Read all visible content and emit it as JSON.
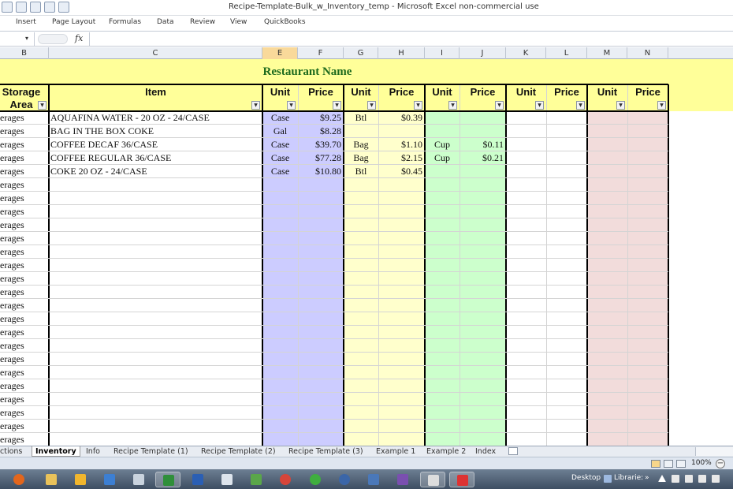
{
  "window": {
    "title": "Recipe-Template-Bulk_w_Inventory_temp  -  Microsoft Excel non-commercial use"
  },
  "ribbon": {
    "tabs": [
      "Insert",
      "Page Layout",
      "Formulas",
      "Data",
      "Review",
      "View",
      "QuickBooks"
    ]
  },
  "formula_bar": {
    "fx_label": "fx",
    "name_box_arrow": "▾"
  },
  "columns": [
    "B",
    "C",
    "E",
    "F",
    "G",
    "H",
    "I",
    "J",
    "K",
    "L",
    "M",
    "N"
  ],
  "selected_column": "E",
  "sheet": {
    "title": "Restaurant Name",
    "headers": {
      "storage_area_line1": "Storage",
      "storage_area_line2": "Area",
      "item": "Item",
      "unit1": "Unit",
      "price1": "Price",
      "unit2": "Unit",
      "price2": "Price",
      "unit3": "Unit",
      "price3": "Price",
      "unit4": "Unit",
      "price4": "Price",
      "unit5": "Unit",
      "price5": "Price"
    },
    "rows": [
      {
        "area": "erages",
        "item": "AQUAFINA WATER - 20 OZ - 24/CASE",
        "u1": "Case",
        "p1": "$9.25",
        "u2": "Btl",
        "p2": "$0.39",
        "u3": "",
        "p3": ""
      },
      {
        "area": "erages",
        "item": "BAG IN THE BOX COKE",
        "u1": "Gal",
        "p1": "$8.28",
        "u2": "",
        "p2": "",
        "u3": "",
        "p3": ""
      },
      {
        "area": "erages",
        "item": "COFFEE DECAF 36/CASE",
        "u1": "Case",
        "p1": "$39.70",
        "u2": "Bag",
        "p2": "$1.10",
        "u3": "Cup",
        "p3": "$0.11"
      },
      {
        "area": "erages",
        "item": "COFFEE REGULAR 36/CASE",
        "u1": "Case",
        "p1": "$77.28",
        "u2": "Bag",
        "p2": "$2.15",
        "u3": "Cup",
        "p3": "$0.21"
      },
      {
        "area": "erages",
        "item": "COKE 20 OZ - 24/CASE",
        "u1": "Case",
        "p1": "$10.80",
        "u2": "Btl",
        "p2": "$0.45",
        "u3": "",
        "p3": ""
      },
      {
        "area": "erages",
        "item": "",
        "u1": "",
        "p1": "",
        "u2": "",
        "p2": "",
        "u3": "",
        "p3": ""
      },
      {
        "area": "erages",
        "item": "",
        "u1": "",
        "p1": "",
        "u2": "",
        "p2": "",
        "u3": "",
        "p3": ""
      },
      {
        "area": "erages",
        "item": "",
        "u1": "",
        "p1": "",
        "u2": "",
        "p2": "",
        "u3": "",
        "p3": ""
      },
      {
        "area": "erages",
        "item": "",
        "u1": "",
        "p1": "",
        "u2": "",
        "p2": "",
        "u3": "",
        "p3": ""
      },
      {
        "area": "erages",
        "item": "",
        "u1": "",
        "p1": "",
        "u2": "",
        "p2": "",
        "u3": "",
        "p3": ""
      },
      {
        "area": "erages",
        "item": "",
        "u1": "",
        "p1": "",
        "u2": "",
        "p2": "",
        "u3": "",
        "p3": ""
      },
      {
        "area": "erages",
        "item": "",
        "u1": "",
        "p1": "",
        "u2": "",
        "p2": "",
        "u3": "",
        "p3": ""
      },
      {
        "area": "erages",
        "item": "",
        "u1": "",
        "p1": "",
        "u2": "",
        "p2": "",
        "u3": "",
        "p3": ""
      },
      {
        "area": "erages",
        "item": "",
        "u1": "",
        "p1": "",
        "u2": "",
        "p2": "",
        "u3": "",
        "p3": ""
      },
      {
        "area": "erages",
        "item": "",
        "u1": "",
        "p1": "",
        "u2": "",
        "p2": "",
        "u3": "",
        "p3": ""
      },
      {
        "area": "erages",
        "item": "",
        "u1": "",
        "p1": "",
        "u2": "",
        "p2": "",
        "u3": "",
        "p3": ""
      },
      {
        "area": "erages",
        "item": "",
        "u1": "",
        "p1": "",
        "u2": "",
        "p2": "",
        "u3": "",
        "p3": ""
      },
      {
        "area": "erages",
        "item": "",
        "u1": "",
        "p1": "",
        "u2": "",
        "p2": "",
        "u3": "",
        "p3": ""
      },
      {
        "area": "erages",
        "item": "",
        "u1": "",
        "p1": "",
        "u2": "",
        "p2": "",
        "u3": "",
        "p3": ""
      },
      {
        "area": "erages",
        "item": "",
        "u1": "",
        "p1": "",
        "u2": "",
        "p2": "",
        "u3": "",
        "p3": ""
      },
      {
        "area": "erages",
        "item": "",
        "u1": "",
        "p1": "",
        "u2": "",
        "p2": "",
        "u3": "",
        "p3": ""
      },
      {
        "area": "erages",
        "item": "",
        "u1": "",
        "p1": "",
        "u2": "",
        "p2": "",
        "u3": "",
        "p3": ""
      },
      {
        "area": "erages",
        "item": "",
        "u1": "",
        "p1": "",
        "u2": "",
        "p2": "",
        "u3": "",
        "p3": ""
      },
      {
        "area": "erages",
        "item": "",
        "u1": "",
        "p1": "",
        "u2": "",
        "p2": "",
        "u3": "",
        "p3": ""
      },
      {
        "area": "erages",
        "item": "",
        "u1": "",
        "p1": "",
        "u2": "",
        "p2": "",
        "u3": "",
        "p3": ""
      }
    ],
    "band_colors": {
      "purple": "#ccccff",
      "yellow": "#ffffcc",
      "green": "#ccffcc",
      "white": "#ffffff",
      "pink": "#f2dcdb",
      "title_yellow": "#ffff99",
      "title_green": "#1d6a1d"
    }
  },
  "sheet_tabs": {
    "items": [
      "ctions",
      "Inventory",
      "Info",
      "Recipe Template (1)",
      "Recipe Template (2)",
      "Recipe Template (3)",
      "Example 1",
      "Example 2",
      "Index"
    ],
    "active": "Inventory"
  },
  "status_bar": {
    "zoom": "100%",
    "zoom_minus": "−"
  },
  "taskbar": {
    "desktop_label": "Desktop",
    "libraries_label": "Librarie:",
    "overflow": "»"
  }
}
